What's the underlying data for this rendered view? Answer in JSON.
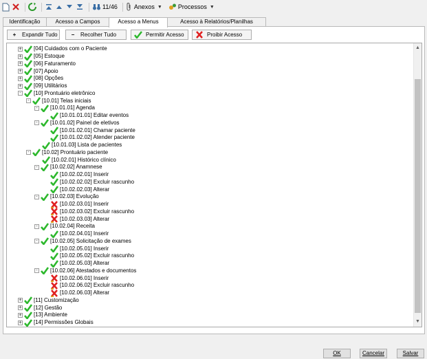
{
  "toolbar": {
    "record_counter": "11/46",
    "attachments_label": "Anexos",
    "processes_label": "Processos"
  },
  "tabs": [
    {
      "label": "Identificação"
    },
    {
      "label": "Acesso a Campos"
    },
    {
      "label": "Acesso a Menus"
    },
    {
      "label": "Acesso à Relatórios/Planilhas"
    }
  ],
  "actions": {
    "expand_all": "Expandir Tudo",
    "collapse_all": "Recolher Tudo",
    "permit": "Permitir Acesso",
    "deny": "Proibir Acesso"
  },
  "colors": {
    "allowed": "#2db82d",
    "denied": "#e02020",
    "partial": "#e0a020"
  },
  "tree": [
    {
      "label": "[04] Cuidados com o Paciente",
      "level": 0,
      "toggle": "plus",
      "state": "allowed"
    },
    {
      "label": "[05] Estoque",
      "level": 0,
      "toggle": "plus",
      "state": "allowed"
    },
    {
      "label": "[06] Faturamento",
      "level": 0,
      "toggle": "plus",
      "state": "allowed"
    },
    {
      "label": "[07] Apoio",
      "level": 0,
      "toggle": "plus",
      "state": "allowed"
    },
    {
      "label": "[08] Opções",
      "level": 0,
      "toggle": "plus",
      "state": "allowed"
    },
    {
      "label": "[09] Utilitários",
      "level": 0,
      "toggle": "plus",
      "state": "allowed"
    },
    {
      "label": "[10] Prontuário eletrônico",
      "level": 0,
      "toggle": "minus",
      "state": "allowed"
    },
    {
      "label": "[10.01] Telas iniciais",
      "level": 1,
      "toggle": "minus",
      "state": "allowed"
    },
    {
      "label": "[10.01.01] Agenda",
      "level": 2,
      "toggle": "minus",
      "state": "allowed"
    },
    {
      "label": "[10.01.01.01] Editar eventos",
      "level": 3,
      "toggle": "none",
      "state": "allowed"
    },
    {
      "label": "[10.01.02] Painel de eletivos",
      "level": 2,
      "toggle": "minus",
      "state": "allowed"
    },
    {
      "label": "[10.01.02.01] Chamar paciente",
      "level": 3,
      "toggle": "none",
      "state": "allowed"
    },
    {
      "label": "[10.01.02.02] Atender paciente",
      "level": 3,
      "toggle": "none",
      "state": "allowed"
    },
    {
      "label": "[10.01.03] Lista de pacientes",
      "level": 2,
      "toggle": "none",
      "state": "allowed"
    },
    {
      "label": "[10.02] Prontuário paciente",
      "level": 1,
      "toggle": "minus",
      "state": "allowed"
    },
    {
      "label": "[10.02.01] Histórico clínico",
      "level": 2,
      "toggle": "none",
      "state": "allowed"
    },
    {
      "label": "[10.02.02] Anamnese",
      "level": 2,
      "toggle": "minus",
      "state": "allowed"
    },
    {
      "label": "[10.02.02.01] Inserir",
      "level": 3,
      "toggle": "none",
      "state": "allowed"
    },
    {
      "label": "[10.02.02.02] Excluir rascunho",
      "level": 3,
      "toggle": "none",
      "state": "allowed"
    },
    {
      "label": "[10.02.02.03] Alterar",
      "level": 3,
      "toggle": "none",
      "state": "allowed"
    },
    {
      "label": "[10.02.03] Evolução",
      "level": 2,
      "toggle": "minus",
      "state": "allowed"
    },
    {
      "label": "[10.02.03.01] Inserir",
      "level": 3,
      "toggle": "none",
      "state": "denied"
    },
    {
      "label": "[10.02.03.02] Excluir rascunho",
      "level": 3,
      "toggle": "none",
      "state": "denied"
    },
    {
      "label": "[10.02.03.03] Alterar",
      "level": 3,
      "toggle": "none",
      "state": "denied"
    },
    {
      "label": "[10.02.04] Receita",
      "level": 2,
      "toggle": "minus",
      "state": "allowed"
    },
    {
      "label": "[10.02.04.01] Inserir",
      "level": 3,
      "toggle": "none",
      "state": "allowed"
    },
    {
      "label": "[10.02.05] Solicitação de exames",
      "level": 2,
      "toggle": "minus",
      "state": "allowed"
    },
    {
      "label": "[10.02.05.01] Inserir",
      "level": 3,
      "toggle": "none",
      "state": "allowed"
    },
    {
      "label": "[10.02.05.02] Excluir rascunho",
      "level": 3,
      "toggle": "none",
      "state": "allowed"
    },
    {
      "label": "[10.02.05.03] Alterar",
      "level": 3,
      "toggle": "none",
      "state": "allowed"
    },
    {
      "label": "[10.02.06] Atestados e documentos",
      "level": 2,
      "toggle": "minus",
      "state": "allowed"
    },
    {
      "label": "[10.02.06.01] Inserir",
      "level": 3,
      "toggle": "none",
      "state": "denied"
    },
    {
      "label": "[10.02.06.02] Excluir rascunho",
      "level": 3,
      "toggle": "none",
      "state": "denied"
    },
    {
      "label": "[10.02.06.03] Alterar",
      "level": 3,
      "toggle": "none",
      "state": "denied"
    },
    {
      "label": "[11] Customização",
      "level": 0,
      "toggle": "plus",
      "state": "allowed"
    },
    {
      "label": "[12] Gestão",
      "level": 0,
      "toggle": "plus",
      "state": "allowed"
    },
    {
      "label": "[13] Ambiente",
      "level": 0,
      "toggle": "plus",
      "state": "allowed"
    },
    {
      "label": "[14] Permissões Globais",
      "level": 0,
      "toggle": "plus",
      "state": "allowed"
    }
  ],
  "footer": {
    "ok": "OK",
    "cancel": "Cancelar",
    "save": "Salvar"
  }
}
